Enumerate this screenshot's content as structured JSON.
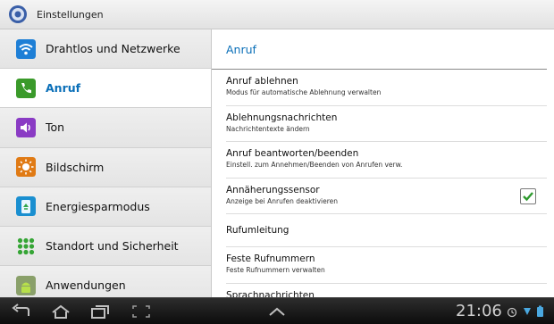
{
  "app": {
    "title": "Einstellungen",
    "icon": "settings-gear-icon"
  },
  "sidebar": {
    "items": [
      {
        "label": "Drahtlos und Netzwerke",
        "icon": "wifi-icon",
        "active": false
      },
      {
        "label": "Anruf",
        "icon": "phone-icon",
        "active": true
      },
      {
        "label": "Ton",
        "icon": "speaker-icon",
        "active": false
      },
      {
        "label": "Bildschirm",
        "icon": "brightness-icon",
        "active": false
      },
      {
        "label": "Energiesparmodus",
        "icon": "recycle-icon",
        "active": false
      },
      {
        "label": "Standort und Sicherheit",
        "icon": "location-grid-icon",
        "active": false
      },
      {
        "label": "Anwendungen",
        "icon": "android-icon",
        "active": false
      }
    ]
  },
  "main": {
    "header": "Anruf",
    "rows": [
      {
        "title": "Anruf ablehnen",
        "subtitle": "Modus für automatische Ablehnung verwalten"
      },
      {
        "title": "Ablehnungsnachrichten",
        "subtitle": "Nachrichtentexte ändern"
      },
      {
        "title": "Anruf beantworten/beenden",
        "subtitle": "Einstell. zum Annehmen/Beenden von Anrufen verw."
      },
      {
        "title": "Annäherungssensor",
        "subtitle": "Anzeige bei Anrufen deaktivieren",
        "checked": true
      },
      {
        "title": "Rufumleitung"
      },
      {
        "title": "Feste Rufnummern",
        "subtitle": "Feste Rufnummern verwalten"
      },
      {
        "title": "Sprachnachrichten"
      }
    ]
  },
  "statusbar": {
    "time": "21:06"
  },
  "colors": {
    "accent": "#0a6fb8",
    "check": "#2e9a2e"
  }
}
